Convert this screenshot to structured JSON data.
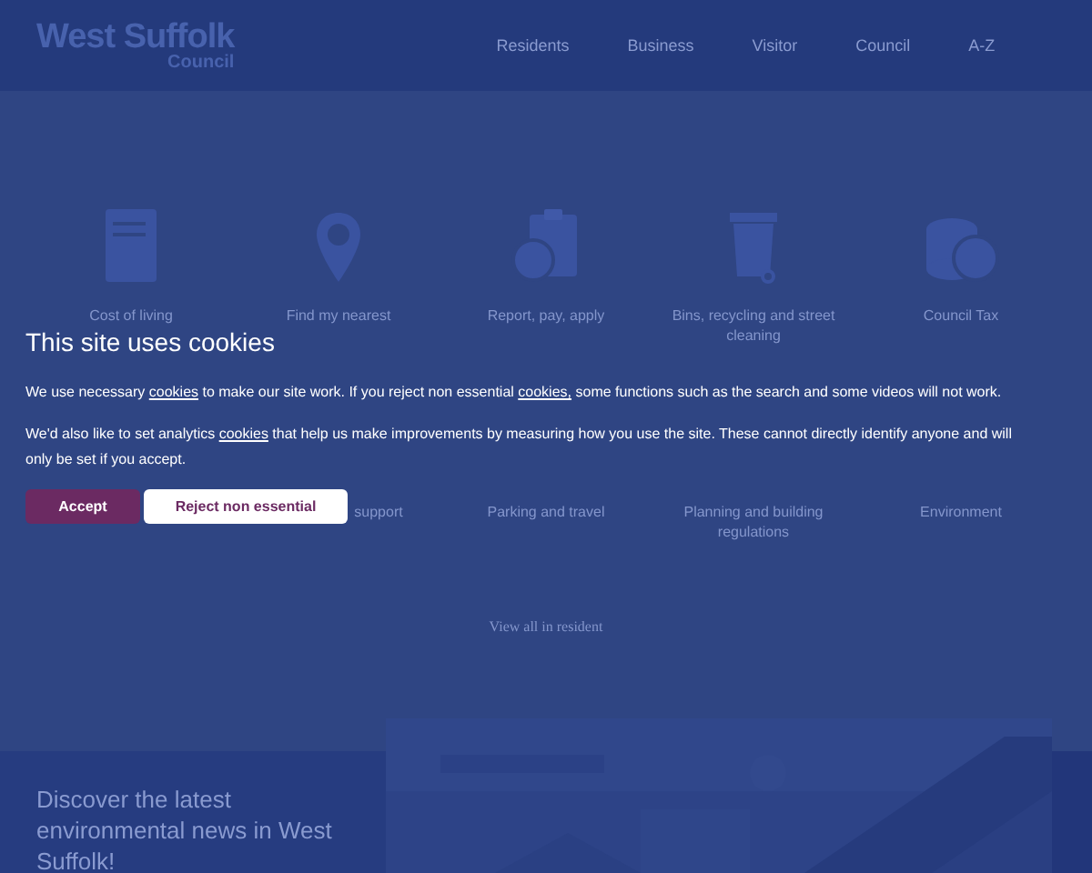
{
  "header": {
    "logo": {
      "title": "West Suffolk",
      "subtitle": "Council"
    },
    "nav": [
      "Residents",
      "Business",
      "Visitor",
      "Council",
      "A-Z"
    ]
  },
  "tiles": [
    {
      "label": "Cost of living",
      "kind": "document"
    },
    {
      "label": "Find my nearest",
      "kind": "pin"
    },
    {
      "label": "Report, pay, apply",
      "kind": "clipboard"
    },
    {
      "label": "Bins, recycling and street cleaning",
      "kind": "bin"
    },
    {
      "label": "Council Tax",
      "kind": "coins"
    },
    {
      "kind": "none"
    },
    {
      "label": "support",
      "kind": "none"
    },
    {
      "label": "Parking and travel",
      "kind": "none"
    },
    {
      "label": "Planning and building regulations",
      "kind": "none"
    },
    {
      "label": "Environment",
      "kind": "none"
    }
  ],
  "view_all_link": "View all in resident",
  "feature": {
    "heading": "Discover the latest environmental news in West Suffolk!"
  },
  "cookie_banner": {
    "title": "This site uses cookies",
    "paragraphs": [
      [
        {
          "kind": "text",
          "text": "We use necessary "
        },
        {
          "kind": "link",
          "text": "cookies"
        },
        {
          "kind": "text",
          "text": " to make our site work. If you reject non essential "
        },
        {
          "kind": "link",
          "text": "cookies,"
        },
        {
          "kind": "text",
          "text": " some functions such as the search and some videos will not work."
        }
      ],
      [
        {
          "kind": "text",
          "text": "We'd also like to set analytics "
        },
        {
          "kind": "link",
          "text": "cookies"
        },
        {
          "kind": "text",
          "text": " that help us make improvements by measuring how you use the site. These cannot directly identify anyone and will only be set if you accept."
        }
      ]
    ],
    "buttons": [
      {
        "label": "Accept",
        "kind": "primary"
      },
      {
        "label": "Reject non essential",
        "kind": "secondary"
      }
    ]
  }
}
